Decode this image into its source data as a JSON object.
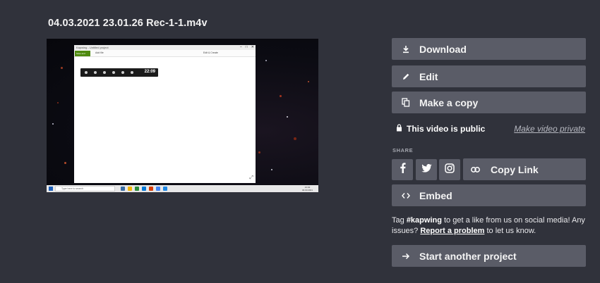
{
  "page": {
    "title": "04.03.2021 23.01.26 Rec-1-1.m4v"
  },
  "preview": {
    "window_title": "Kapwing - Untitled project",
    "badge_text": "Save and publish",
    "add_text": "Add file",
    "menu_text": "Edit & Create",
    "hud_time": "22:09",
    "search_text": "Type here to search",
    "clock_time": "21:02",
    "clock_date": "04.03.2021"
  },
  "actions": {
    "download": {
      "label": "Download",
      "icon": "download-icon"
    },
    "edit": {
      "label": "Edit",
      "icon": "pencil-icon"
    },
    "copy": {
      "label": "Make a copy",
      "icon": "copy-icon"
    }
  },
  "visibility": {
    "status": "This video is public",
    "toggle_link": "Make video private",
    "icon": "lock-icon"
  },
  "share": {
    "heading": "SHARE",
    "social": [
      "facebook-icon",
      "twitter-icon",
      "instagram-icon"
    ],
    "copy_link": "Copy Link",
    "embed": "Embed"
  },
  "tag": {
    "prefix": "Tag",
    "hashtag": "#kapwing",
    "middle": "to get a like from us on social media! Any issues?",
    "report_link": "Report a problem",
    "suffix": "to let us know."
  },
  "cta": {
    "label": "Start another project",
    "icon": "arrow-right-icon"
  },
  "colors": {
    "background": "#30323b",
    "button": "#5a5c67",
    "text": "#ffffff"
  }
}
